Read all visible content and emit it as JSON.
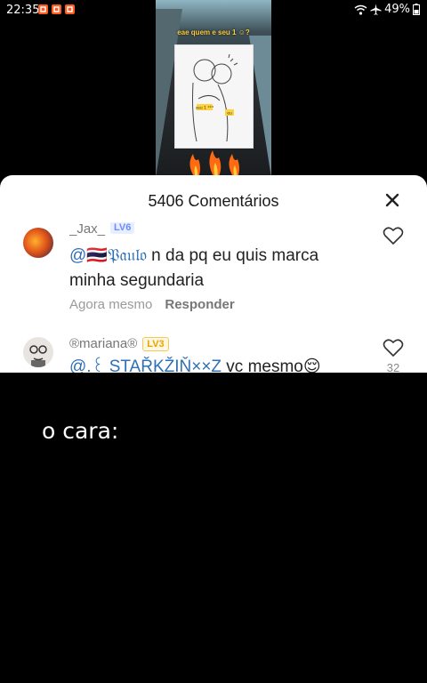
{
  "status_bar": {
    "time": "22:35",
    "battery": "49%"
  },
  "video": {
    "caption": "eae quem e seu 1 ☺?",
    "sketch_tag_left": "seu 1 ***",
    "sketch_tag_right": "eu"
  },
  "comments_sheet": {
    "title": "5406 Comentários",
    "comments": [
      {
        "username": "_Jax_",
        "level": "LV6",
        "mention": "@🇹🇭𝔓𝔞𝔲𝔩𝔬",
        "text": " n da pq eu quis marca minha segundaria",
        "time": "Agora mesmo",
        "reply_label": "Responder"
      },
      {
        "username": "®mariana®",
        "level": "LV3",
        "mention": "@.꒰ STAŘKŽIŇ××Z",
        "text": "  vc mesmo😌",
        "like_count": "32"
      }
    ]
  },
  "overlay": {
    "text": "o cara:"
  },
  "colors": {
    "mention": "#2f6fb5",
    "level6": "#6b8cff",
    "level3": "#e8a400"
  }
}
